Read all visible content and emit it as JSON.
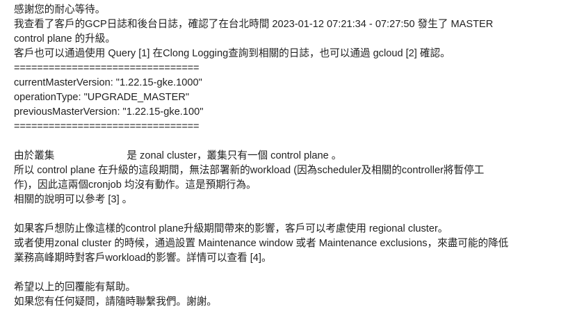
{
  "message": {
    "greeting": "感謝您的耐心等待。",
    "p1_line1": "我查看了客戶的GCP日誌和後台日誌，確認了在台北時間 2023-01-12 07:21:34 - 07:27:50 發生了 MASTER",
    "p1_line2": "control plane 的升級。",
    "p1_line3": "客戶也可以通過使用 Query [1] 在Clong Logging查詢到相關的日誌，也可以通過 gcloud [2] 確認。",
    "separator": "================================",
    "log": {
      "current_master_version": "currentMasterVersion: \"1.22.15-gke.1000\"",
      "operation_type": "operationType: \"UPGRADE_MASTER\"",
      "previous_master_version": "previousMasterVersion: \"1.22.15-gke.100\""
    },
    "p2_line1_pre": "由於叢集",
    "p2_line1_post": "是 zonal cluster，叢集只有一個 control plane 。",
    "p2_line2": "所以 control plane 在升級的這段期間，無法部署新的workload (因為scheduler及相關的controller將暫停工",
    "p2_line3": "作)，因此這兩個cronjob 均沒有動作。這是預期行為。",
    "p2_line4": "相關的說明可以參考 [3] 。",
    "p3_line1": "如果客戶想防止像這樣的control plane升級期間帶來的影響，客戶可以考慮使用 regional cluster。",
    "p3_line2": "或者使用zonal cluster 的時候，通過設置 Maintenance window 或者 Maintenance exclusions，來盡可能的降低",
    "p3_line3": "業務高峰期時對客戶workload的影響。詳情可以查看 [4]。",
    "closing1": "希望以上的回覆能有幫助。",
    "closing2": "如果您有任何疑問，請隨時聯繫我們。謝謝。"
  }
}
